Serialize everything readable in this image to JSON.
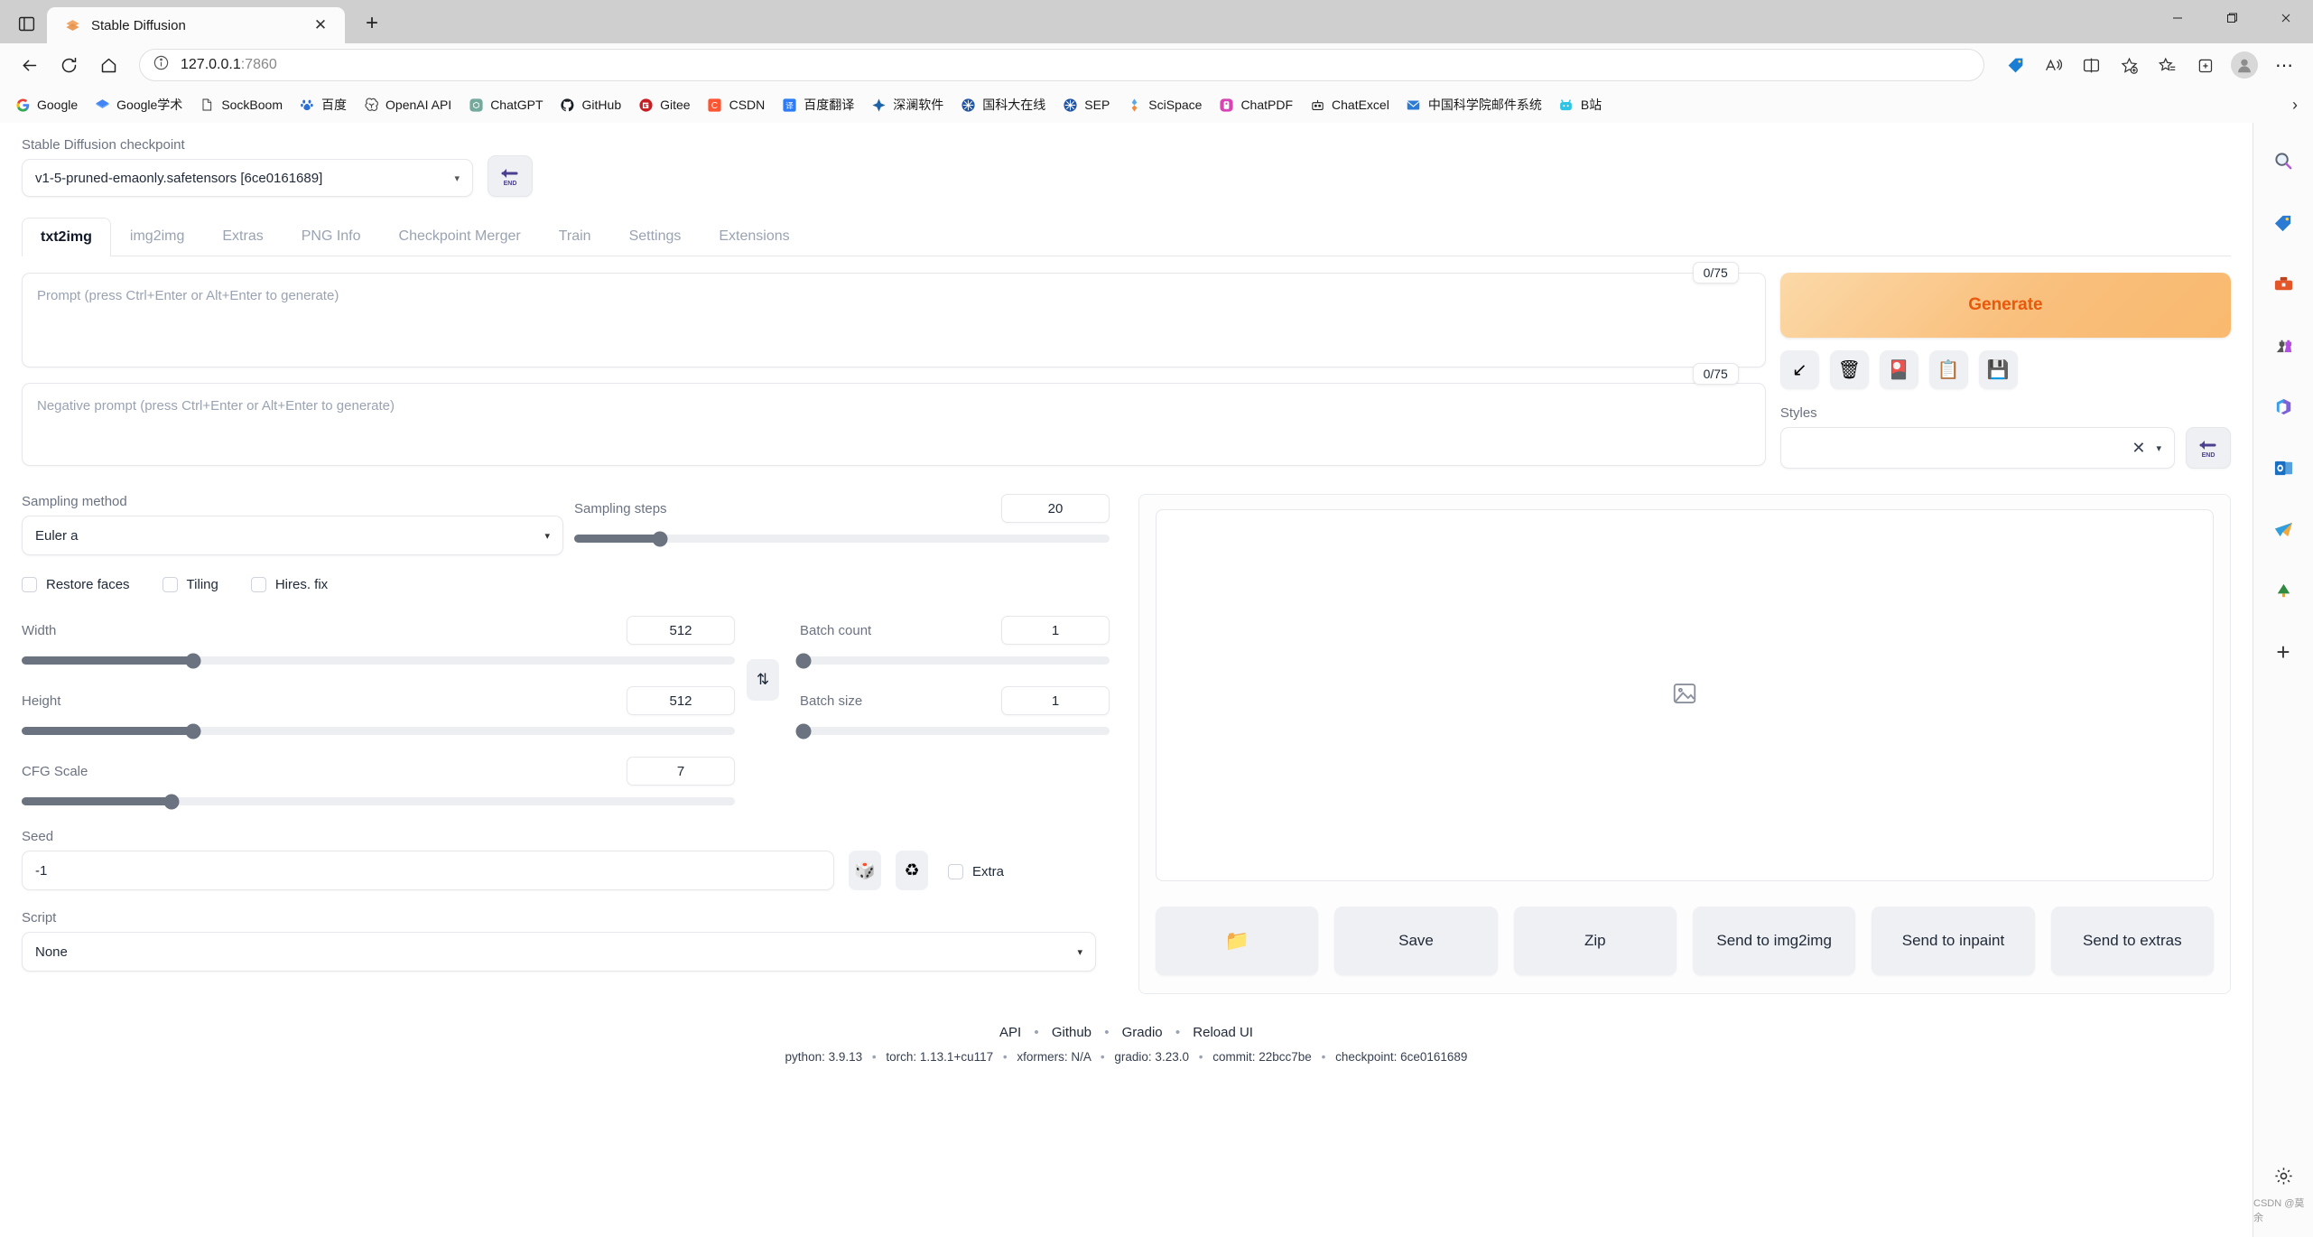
{
  "browser": {
    "tab": {
      "title": "Stable Diffusion",
      "favicon": "stable-diffusion-icon",
      "close_label": "✕"
    },
    "new_tab_label": "+",
    "url": "127.0.0.1",
    "url_port": ":7860",
    "window_controls": {
      "minimize": "—",
      "maximize": "❐",
      "close": "✕"
    },
    "overflow_label": "⋯",
    "bookmarks_overflow": "›",
    "bookmarks": [
      {
        "label": "Google",
        "icon": "google-icon"
      },
      {
        "label": "Google学术",
        "icon": "google-scholar-icon"
      },
      {
        "label": "SockBoom",
        "icon": "page-icon"
      },
      {
        "label": "百度",
        "icon": "baidu-icon"
      },
      {
        "label": "OpenAI API",
        "icon": "openai-icon"
      },
      {
        "label": "ChatGPT",
        "icon": "chatgpt-icon"
      },
      {
        "label": "GitHub",
        "icon": "github-icon"
      },
      {
        "label": "Gitee",
        "icon": "gitee-icon"
      },
      {
        "label": "CSDN",
        "icon": "csdn-icon"
      },
      {
        "label": "百度翻译",
        "icon": "baidu-translate-icon"
      },
      {
        "label": "深澜软件",
        "icon": "shenlan-icon"
      },
      {
        "label": "国科大在线",
        "icon": "ucas-icon"
      },
      {
        "label": "SEP",
        "icon": "sep-icon"
      },
      {
        "label": "SciSpace",
        "icon": "scispace-icon"
      },
      {
        "label": "ChatPDF",
        "icon": "chatpdf-icon"
      },
      {
        "label": "ChatExcel",
        "icon": "chatexcel-icon"
      },
      {
        "label": "中国科学院邮件系统",
        "icon": "mail-icon"
      },
      {
        "label": "B站",
        "icon": "bilibili-icon"
      }
    ],
    "sidebar_icons": [
      "search-icon",
      "shopping-tag-icon",
      "tools-icon",
      "games-icon",
      "microsoft365-icon",
      "outlook-icon",
      "telegram-icon",
      "tree-icon",
      "add-icon"
    ],
    "sidebar_add_label": "+",
    "settings_gear_label": "⚙",
    "watermark": "CSDN @莫余"
  },
  "app": {
    "checkpoint": {
      "label": "Stable Diffusion checkpoint",
      "value": "v1-5-pruned-emaonly.safetensors [6ce0161689]",
      "caret": "▾",
      "refresh_icon": "arrow-end-icon"
    },
    "tabs": [
      {
        "label": "txt2img",
        "active": true
      },
      {
        "label": "img2img",
        "active": false
      },
      {
        "label": "Extras",
        "active": false
      },
      {
        "label": "PNG Info",
        "active": false
      },
      {
        "label": "Checkpoint Merger",
        "active": false
      },
      {
        "label": "Train",
        "active": false
      },
      {
        "label": "Settings",
        "active": false
      },
      {
        "label": "Extensions",
        "active": false
      }
    ],
    "prompt": {
      "placeholder": "Prompt (press Ctrl+Enter or Alt+Enter to generate)",
      "value": "",
      "token_count": "0/75"
    },
    "negative_prompt": {
      "placeholder": "Negative prompt (press Ctrl+Enter or Alt+Enter to generate)",
      "value": "",
      "token_count": "0/75"
    },
    "generate_label": "Generate",
    "action_icons": [
      {
        "name": "read-generation-params-icon",
        "glyph": "↙"
      },
      {
        "name": "clear-prompt-icon",
        "glyph": "🗑"
      },
      {
        "name": "show-extra-networks-icon",
        "glyph": "🎴"
      },
      {
        "name": "apply-style-icon",
        "glyph": "📋"
      },
      {
        "name": "save-style-icon",
        "glyph": "💾"
      }
    ],
    "styles": {
      "label": "Styles",
      "value": "",
      "clear_glyph": "✕",
      "caret": "▾",
      "refresh_icon": "arrow-end-icon"
    },
    "sampling_method": {
      "label": "Sampling method",
      "value": "Euler a",
      "caret": "▾"
    },
    "sampling_steps": {
      "label": "Sampling steps",
      "value": "20",
      "percent": 16
    },
    "checkboxes": [
      {
        "label": "Restore faces",
        "checked": false
      },
      {
        "label": "Tiling",
        "checked": false
      },
      {
        "label": "Hires. fix",
        "checked": false
      }
    ],
    "width": {
      "label": "Width",
      "value": "512",
      "percent": 24
    },
    "height": {
      "label": "Height",
      "value": "512",
      "percent": 24
    },
    "cfg_scale": {
      "label": "CFG Scale",
      "value": "7",
      "percent": 21
    },
    "batch_count": {
      "label": "Batch count",
      "value": "1",
      "percent": 0
    },
    "batch_size": {
      "label": "Batch size",
      "value": "1",
      "percent": 0
    },
    "swap_icon": "⇅",
    "seed": {
      "label": "Seed",
      "value": "-1",
      "dice_icon": "🎲",
      "recycle_icon": "♻",
      "extra_label": "Extra",
      "extra_checked": false
    },
    "script": {
      "label": "Script",
      "value": "None",
      "caret": "▾"
    },
    "preview_placeholder_icon": "image-placeholder-icon",
    "output_buttons": [
      {
        "label": "",
        "icon": "folder-icon",
        "glyph": "📁"
      },
      {
        "label": "Save",
        "icon": null,
        "glyph": ""
      },
      {
        "label": "Zip",
        "icon": null,
        "glyph": ""
      },
      {
        "label": "Send to img2img",
        "icon": null,
        "glyph": ""
      },
      {
        "label": "Send to inpaint",
        "icon": null,
        "glyph": ""
      },
      {
        "label": "Send to extras",
        "icon": null,
        "glyph": ""
      }
    ],
    "footer": {
      "links": [
        "API",
        "Github",
        "Gradio",
        "Reload UI"
      ],
      "separator": "•",
      "versions": [
        "python: 3.9.13",
        "torch: 1.13.1+cu117",
        "xformers: N/A",
        "gradio: 3.23.0",
        "commit: 22bcc7be",
        "checkpoint: 6ce0161689"
      ]
    }
  },
  "colors": {
    "accent_orange": "#e8590c",
    "generate_bg": "#f9bf7c",
    "slider_fill": "#6b7280",
    "label_gray": "#6b7280"
  }
}
